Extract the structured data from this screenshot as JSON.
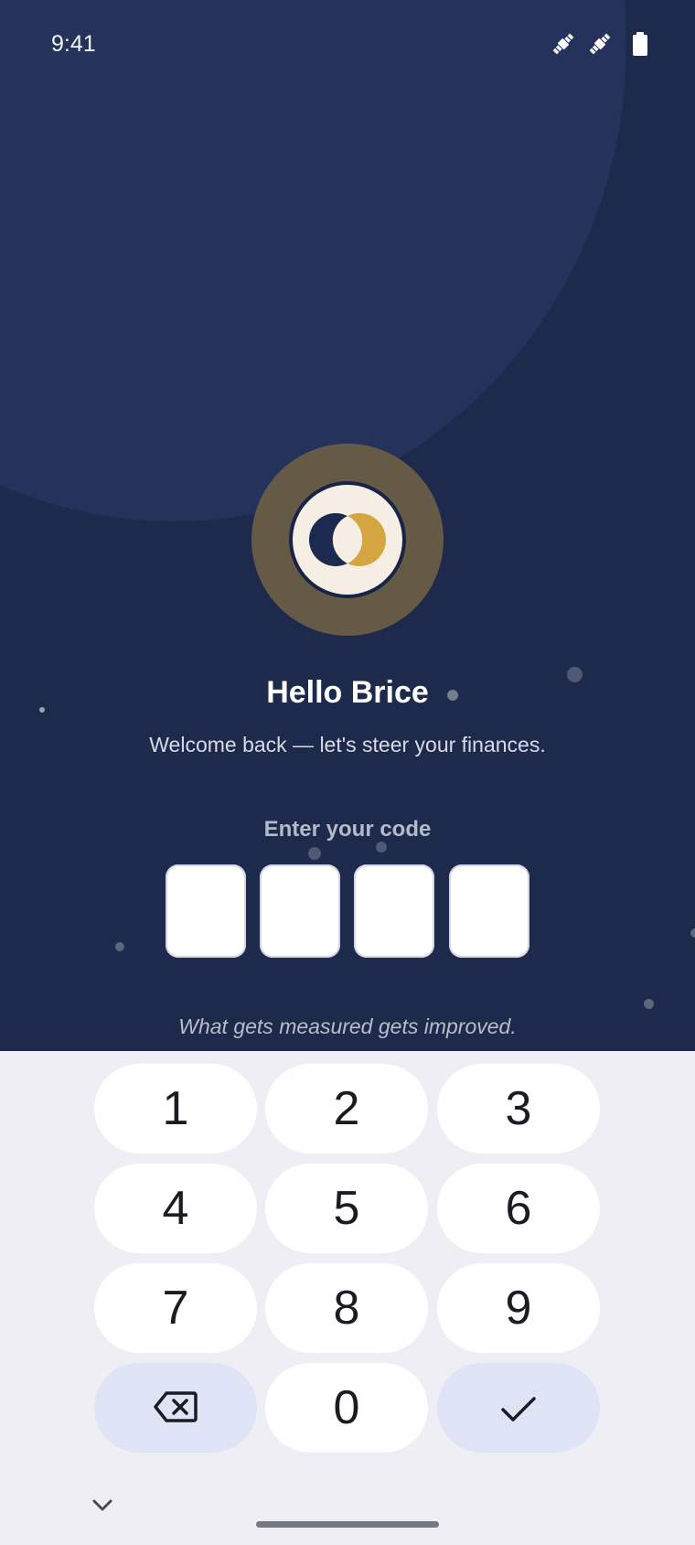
{
  "status_bar": {
    "time": "9:41",
    "icons": [
      "satellite-icon",
      "satellite-icon",
      "battery-icon"
    ]
  },
  "logo": {
    "name": "two-circle-logo-icon",
    "colors": {
      "dark": "#1d2a50",
      "light": "#f5eee4",
      "gold": "#d4a63f"
    }
  },
  "greeting": {
    "title": "Hello Brice",
    "subtitle": "Welcome back — let's steer your finances."
  },
  "code_entry": {
    "label": "Enter your code",
    "digits": [
      "",
      "",
      "",
      ""
    ]
  },
  "quote": "What gets measured gets improved.",
  "keypad": {
    "keys": [
      "1",
      "2",
      "3",
      "4",
      "5",
      "6",
      "7",
      "8",
      "9"
    ],
    "zero": "0",
    "backspace_icon": "backspace-icon",
    "confirm_icon": "checkmark-icon"
  },
  "navigation": {
    "collapse_icon": "chevron-down-icon"
  },
  "colors": {
    "background": "#1e2a4b",
    "accent_circle": "#24325c",
    "keypad_bg": "#eeeef4",
    "action_key": "#dfe3f6"
  }
}
